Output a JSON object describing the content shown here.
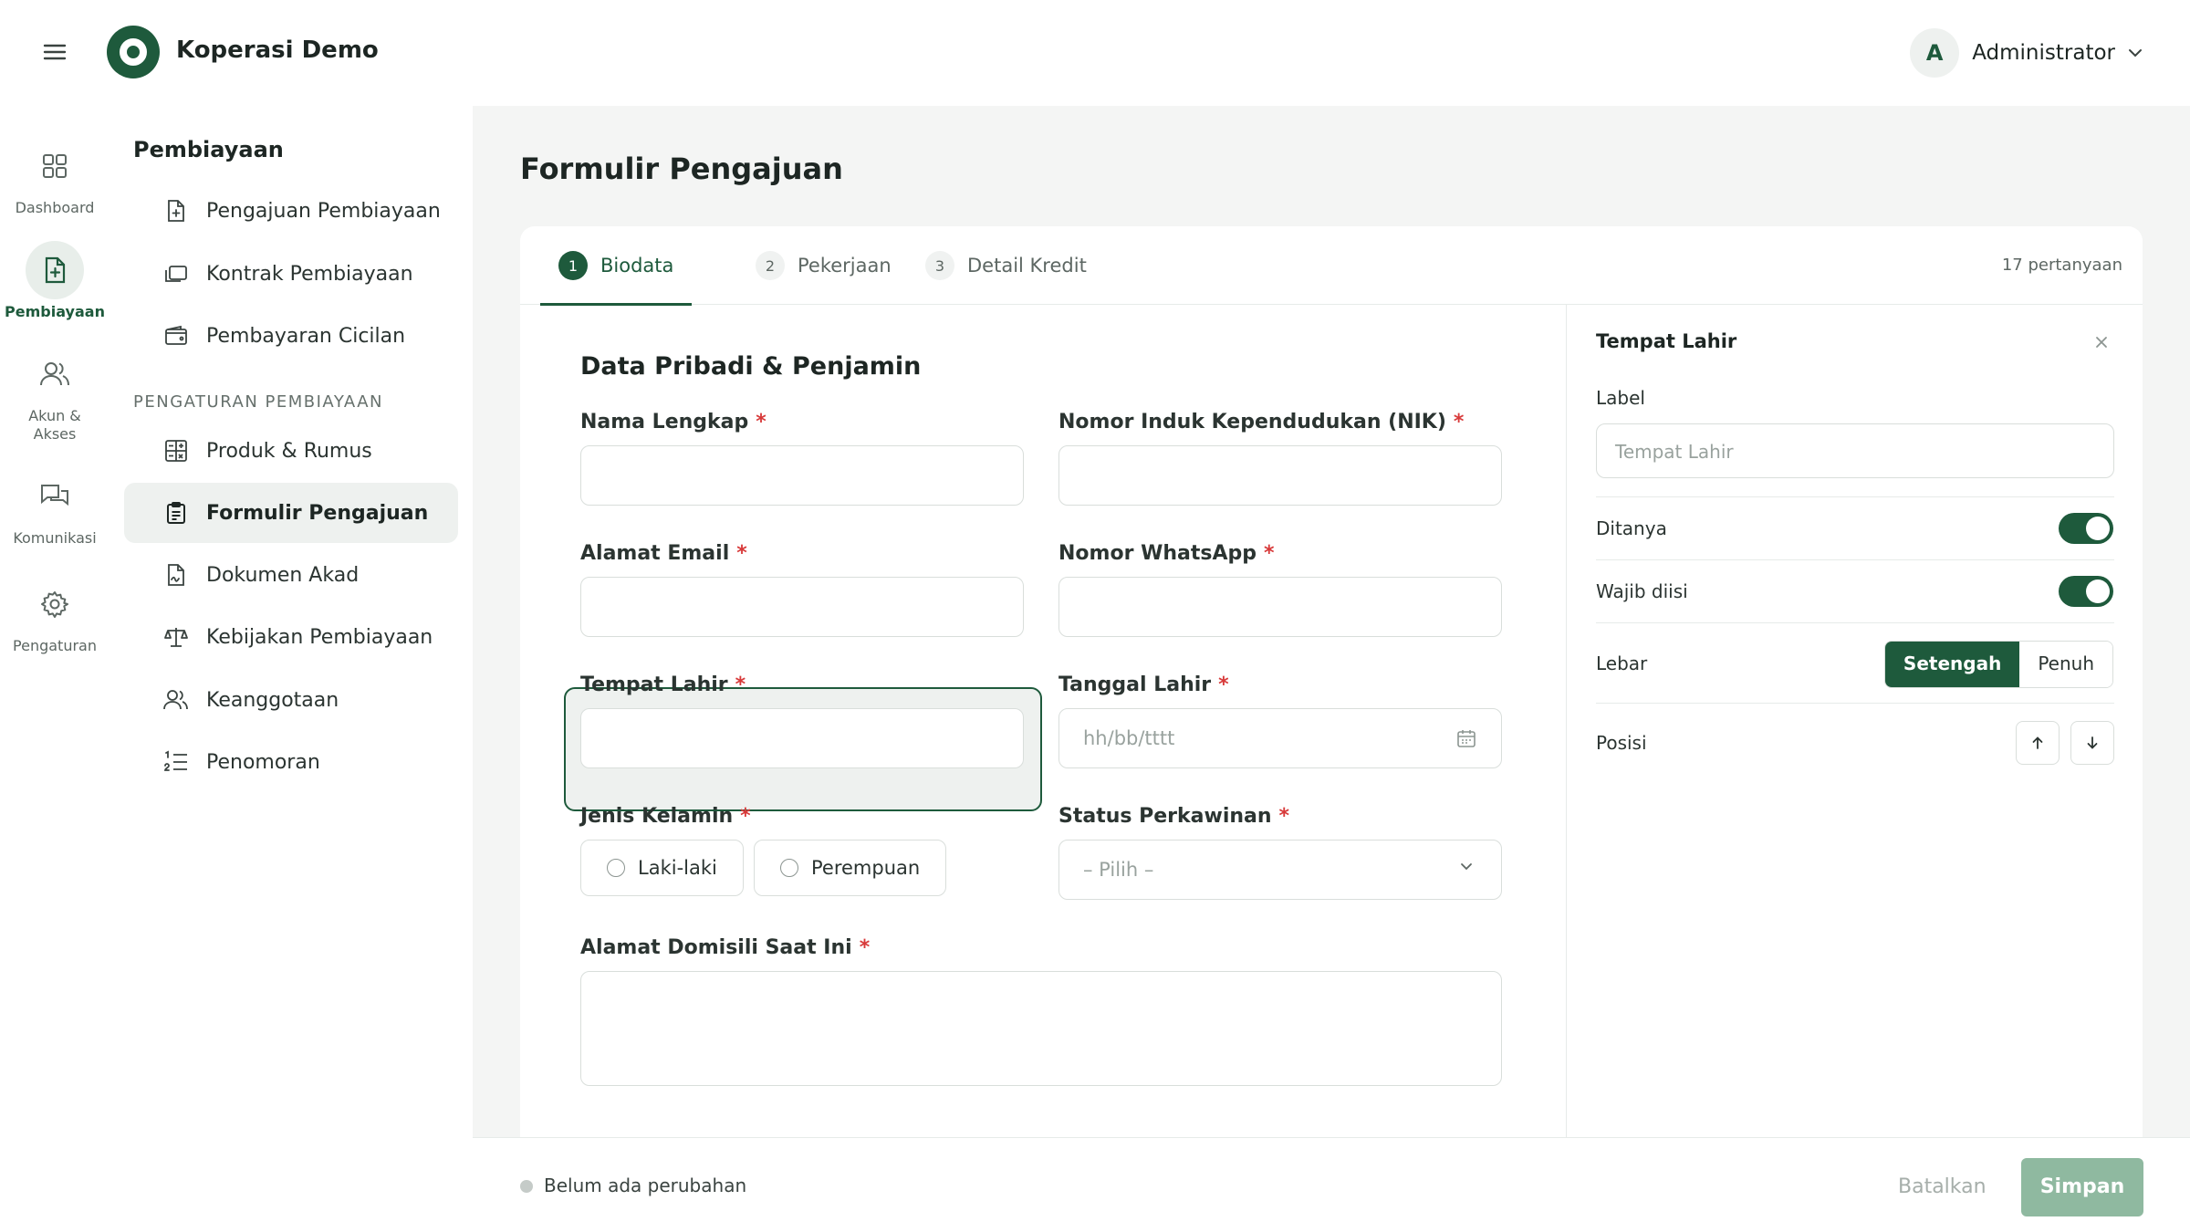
{
  "brand": {
    "name": "Koperasi Demo"
  },
  "user": {
    "initial": "A",
    "name": "Administrator"
  },
  "rail": [
    {
      "label": "Dashboard",
      "icon": "grid-icon"
    },
    {
      "label": "Pembiayaan",
      "icon": "document-plus-icon",
      "active": true
    },
    {
      "label": "Akun & Akses",
      "icon": "users-icon"
    },
    {
      "label": "Komunikasi",
      "icon": "chat-icon"
    },
    {
      "label": "Pengaturan",
      "icon": "gear-icon"
    }
  ],
  "subnav": {
    "title": "Pembiayaan",
    "items": [
      {
        "label": "Pengajuan Pembiayaan",
        "icon": "file-plus-icon"
      },
      {
        "label": "Kontrak Pembiayaan",
        "icon": "stack-icon"
      },
      {
        "label": "Pembayaran Cicilan",
        "icon": "wallet-icon"
      }
    ],
    "section_label": "PENGATURAN PEMBIAYAAN",
    "settings_items": [
      {
        "label": "Produk & Rumus",
        "icon": "calculator-icon"
      },
      {
        "label": "Formulir Pengajuan",
        "icon": "clipboard-icon",
        "active": true
      },
      {
        "label": "Dokumen Akad",
        "icon": "file-signature-icon"
      },
      {
        "label": "Kebijakan Pembiayaan",
        "icon": "scale-icon"
      },
      {
        "label": "Keanggotaan",
        "icon": "users-icon"
      },
      {
        "label": "Penomoran",
        "icon": "numbered-list-icon"
      }
    ]
  },
  "page": {
    "title": "Formulir Pengajuan"
  },
  "tabs": [
    {
      "num": "1",
      "label": "Biodata",
      "active": true
    },
    {
      "num": "2",
      "label": "Pekerjaan"
    },
    {
      "num": "3",
      "label": "Detail Kredit"
    }
  ],
  "question_count": "17 pertanyaan",
  "form": {
    "section_title": "Data Pribadi & Penjamin",
    "required_mark": "*",
    "fields": {
      "nama": "Nama Lengkap",
      "nik": "Nomor Induk Kependudukan (NIK)",
      "email": "Alamat Email",
      "whatsapp": "Nomor WhatsApp",
      "tempat_lahir": "Tempat Lahir",
      "tanggal_lahir": "Tanggal Lahir",
      "jenis_kelamin": "Jenis Kelamin",
      "status": "Status Perkawinan",
      "alamat": "Alamat Domisili Saat Ini"
    },
    "date_placeholder": "hh/bb/tttt",
    "select_placeholder": "– Pilih –",
    "gender_options": [
      "Laki-laki",
      "Perempuan"
    ]
  },
  "props": {
    "title": "Tempat Lahir",
    "label_caption": "Label",
    "label_placeholder": "Tempat Lahir",
    "ditanya": "Ditanya",
    "ditanya_on": true,
    "wajib": "Wajib diisi",
    "wajib_on": true,
    "lebar": "Lebar",
    "lebar_options": [
      "Setengah",
      "Penuh"
    ],
    "lebar_selected": "Setengah",
    "posisi": "Posisi"
  },
  "footer": {
    "status": "Belum ada perubahan",
    "cancel": "Batalkan",
    "save": "Simpan"
  },
  "colors": {
    "accent": "#1e5a3c",
    "required": "#d83a3a",
    "save_disabled": "#8fb9a0"
  }
}
